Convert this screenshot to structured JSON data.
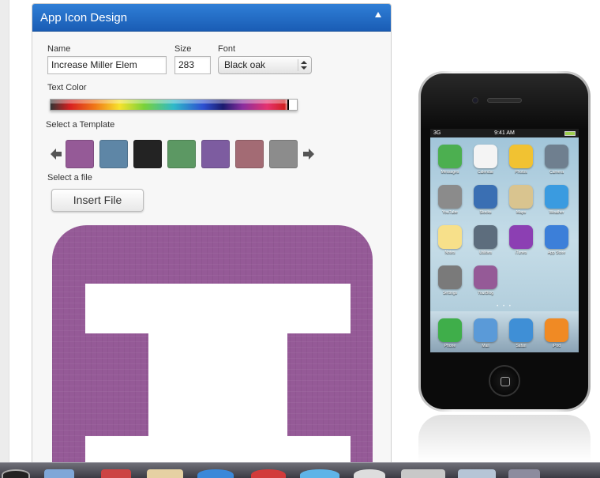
{
  "panel": {
    "title": "App Icon Design"
  },
  "form": {
    "name_label": "Name",
    "name_value": "Increase Miller Elem",
    "size_label": "Size",
    "size_value": "283",
    "font_label": "Font",
    "font_value": "Black oak",
    "text_color_label": "Text Color",
    "template_label": "Select a Template",
    "file_label": "Select a file",
    "insert_button": "Insert File"
  },
  "templates": [
    {
      "name": "template-purple",
      "color": "#955a97"
    },
    {
      "name": "template-blue",
      "color": "#5e86a6"
    },
    {
      "name": "template-black",
      "color": "#232323"
    },
    {
      "name": "template-green",
      "color": "#5c9863"
    },
    {
      "name": "template-violet",
      "color": "#7d5ca0"
    },
    {
      "name": "template-rose",
      "color": "#a36b74"
    },
    {
      "name": "template-gray",
      "color": "#8c8c8c"
    }
  ],
  "preview": {
    "background": "#955a97",
    "glyph": "I"
  },
  "phone": {
    "carrier": "3G",
    "time": "9:41 AM",
    "apps": [
      {
        "label": "Messages",
        "color": "#4caf50"
      },
      {
        "label": "Calendar",
        "color": "#f4f4f4"
      },
      {
        "label": "Photos",
        "color": "#f1c232"
      },
      {
        "label": "Camera",
        "color": "#6f7f8f"
      },
      {
        "label": "YouTube",
        "color": "#8b8b8b"
      },
      {
        "label": "Stocks",
        "color": "#3a6fb3"
      },
      {
        "label": "Maps",
        "color": "#d9c48f"
      },
      {
        "label": "Weather",
        "color": "#3a9be0"
      },
      {
        "label": "Notes",
        "color": "#f7e08a"
      },
      {
        "label": "Utilities",
        "color": "#5d6d7d"
      },
      {
        "label": "iTunes",
        "color": "#8c3fb3"
      },
      {
        "label": "App Store",
        "color": "#3c7fd9"
      },
      {
        "label": "Settings",
        "color": "#7a7a7a"
      },
      {
        "label": "YourBlog",
        "color": "#955a97"
      }
    ],
    "dock": [
      {
        "label": "Phone",
        "color": "#3fae4a"
      },
      {
        "label": "Mail",
        "color": "#5a9ad8"
      },
      {
        "label": "Safari",
        "color": "#3f8fd6"
      },
      {
        "label": "iPod",
        "color": "#f08a24"
      }
    ]
  }
}
